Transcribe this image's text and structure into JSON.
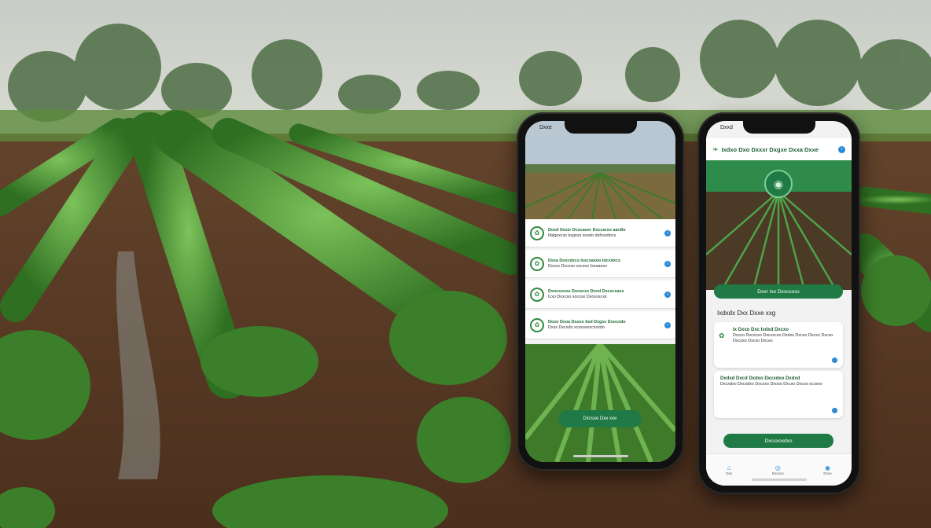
{
  "scene": {
    "sky_color": "#cfd3cc",
    "soil_color": "#5a3a24",
    "plant_color": "#3f8a2c"
  },
  "phone_left": {
    "status_time": "Dxxe",
    "cards": [
      {
        "title": "Doxd Ilxosr Dcscaoxr Dxccarxo aardlo",
        "subtitle": "Ifalgoxcxs kxgxxa sosdo dsfxxxdocs",
        "icon": "leaf-icon"
      },
      {
        "title": "Dsxa Doxcdxcs Ixxcxaxoo ldcxdxcs",
        "subtitle": "Dxcso Dxcsxo xscsxo Ixxaasxo",
        "icon": "leaf-icon"
      },
      {
        "title": "Dxocsxoxs Doxxcsx Doxd Dxcxcsaxs",
        "subtitle": "Icxo Doxcxo xocxsx Dxosxscxs",
        "icon": "sprout-icon"
      },
      {
        "title": "Doxo Dxoa Dsxxo Iisd Dxgxs Dxocxdo",
        "subtitle": "Dxsx Dxcxdo xcsxoxoxcxsxdo",
        "icon": "leaf-icon"
      }
    ],
    "button_label": "Dxcsxe Dxe xxe"
  },
  "phone_right": {
    "status_time": "Dxxd",
    "header_title": "Ixdxo Dxo Dxxxr Dxgxe Dxxa Dxxe",
    "hero_button_label": "Dxxr Ixe Dxxcsoxs",
    "section_title": "Ixdxdx Dxx Dxxe xxg",
    "card1": {
      "title": "Ix Dxxo Dxc Ixdxd Dxcxo",
      "subtitle": "Dxcxo Dxcxcxo Dxcsxcxo Dxdxs Dxcxo Dxcxo Dxcso Dxcsxo Dxcxo Dxcso"
    },
    "card2": {
      "title": "Dxdxd Dxcd Dxdxo Dxcxdxo Dxdxd",
      "subtitle": "Dxcxdxo Dxcxdxo Dxcsxo Dxoxo Dxcxo Dxcso xcxsxo"
    },
    "button_label": "Dxcsxoxdxo",
    "nav": [
      {
        "label": "Dxx",
        "icon": "home-icon"
      },
      {
        "label": "Dxcxxo",
        "icon": "globe-icon"
      },
      {
        "label": "Dxxo",
        "icon": "profile-icon"
      }
    ]
  }
}
